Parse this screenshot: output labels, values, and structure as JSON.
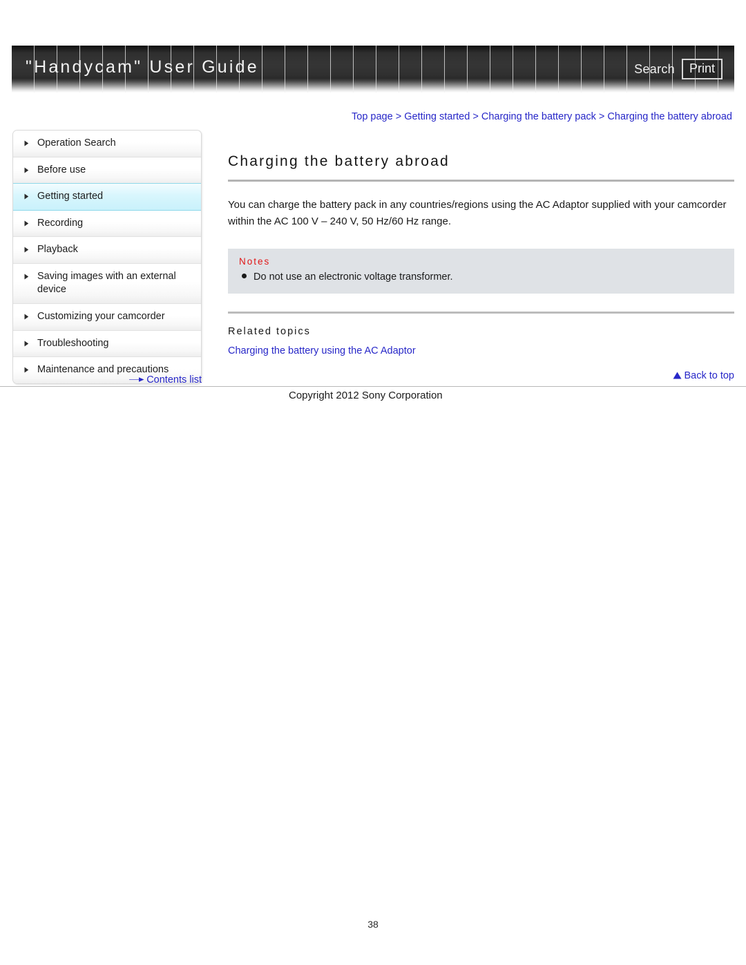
{
  "header": {
    "title": "\"Handycam\" User Guide",
    "search_label": "Search",
    "print_label": "Print"
  },
  "breadcrumb": {
    "separator": " > ",
    "items": [
      {
        "label": "Top page"
      },
      {
        "label": "Getting started"
      },
      {
        "label": "Charging the battery pack"
      },
      {
        "label": "Charging the battery abroad"
      }
    ]
  },
  "sidebar": {
    "items": [
      {
        "label": "Operation Search",
        "icon": "triangle-right-icon",
        "selected": false
      },
      {
        "label": "Before use",
        "icon": "triangle-right-icon",
        "selected": false
      },
      {
        "label": "Getting started",
        "icon": "triangle-right-icon",
        "selected": true
      },
      {
        "label": "Recording",
        "icon": "triangle-right-icon",
        "selected": false
      },
      {
        "label": "Playback",
        "icon": "triangle-right-icon",
        "selected": false
      },
      {
        "label": "Saving images with an external device",
        "icon": "triangle-right-icon",
        "selected": false
      },
      {
        "label": "Customizing your camcorder",
        "icon": "triangle-right-icon",
        "selected": false
      },
      {
        "label": "Troubleshooting",
        "icon": "triangle-right-icon",
        "selected": false
      },
      {
        "label": "Maintenance and precautions",
        "icon": "triangle-right-icon",
        "selected": false
      }
    ],
    "contents_list_label": "Contents list",
    "contents_list_icon": "arrow-right-icon",
    "highlight_color": "#c9f1fb",
    "link_color": "#2727c8"
  },
  "main": {
    "title": "Charging the battery abroad",
    "intro": "You can charge the battery pack in any countries/regions using the AC Adaptor supplied with your camcorder within the AC 100 V – 240 V, 50 Hz/60 Hz range.",
    "notes": {
      "title": "Notes",
      "title_color": "#e01717",
      "background_color": "#dfe2e6",
      "items": [
        "Do not use an electronic voltage transformer."
      ]
    },
    "related": {
      "title": "Related topics",
      "links": [
        "Charging the battery using the AC Adaptor"
      ]
    },
    "back_to_top_label": "Back to top",
    "back_to_top_icon": "triangle-up-icon"
  },
  "footer": {
    "copyright": "Copyright 2012 Sony Corporation",
    "page_number": "38"
  }
}
